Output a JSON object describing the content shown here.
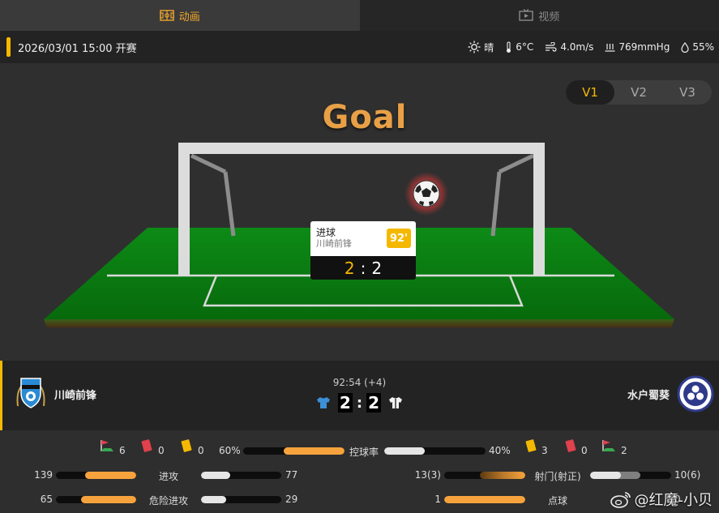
{
  "tabs": [
    {
      "label": "动画",
      "icon": "pitch-icon",
      "active": true
    },
    {
      "label": "视频",
      "icon": "tv-icon",
      "active": false
    }
  ],
  "info": {
    "start": "2026/03/01 15:00 开赛",
    "weather": "晴",
    "temp": "6°C",
    "wind": "4.0m/s",
    "pressure": "769mmHg",
    "humidity": "55%"
  },
  "versions": [
    "V1",
    "V2",
    "V3"
  ],
  "stage": {
    "title": "Goal",
    "event_type": "进球",
    "event_team": "川崎前锋",
    "event_minute": "92'",
    "event_home_score": "2",
    "event_sep": ":",
    "event_away_score": "2"
  },
  "match": {
    "clock": "92:54 (+4)",
    "home_team": "川崎前锋",
    "away_team": "水户蜀葵",
    "home_score": "2",
    "away_score": "2",
    "sep": ":"
  },
  "stats": {
    "home_corners": "6",
    "home_red": "0",
    "home_yellow": "0",
    "home_possession": "60%",
    "possession_label": "控球率",
    "away_possession": "40%",
    "away_yellow": "3",
    "away_red": "0",
    "away_corners": "2",
    "possession_home_fraction": 0.6,
    "rows": [
      {
        "label": "进攻",
        "home": "139",
        "away": "77",
        "home_frac": 0.64,
        "away_frac": 0.36
      },
      {
        "label": "危险进攻",
        "home": "65",
        "away": "29",
        "home_frac": 0.69,
        "away_frac": 0.31
      }
    ],
    "rows_right": [
      {
        "label": "射门(射正)",
        "home": "13(3)",
        "away": "10(6)",
        "home_frac": 0.56,
        "away_frac": 0.44
      },
      {
        "label": "点球",
        "home": "1",
        "away": "0",
        "home_frac": 1.0,
        "away_frac": 0.0
      }
    ]
  },
  "watermark": "@红魔-小贝",
  "colors": {
    "accent": "#f5b800",
    "home": "#f6a33d",
    "away": "#e6e6e6",
    "yellow_card": "#f5b800",
    "red_card": "#e0414d"
  }
}
